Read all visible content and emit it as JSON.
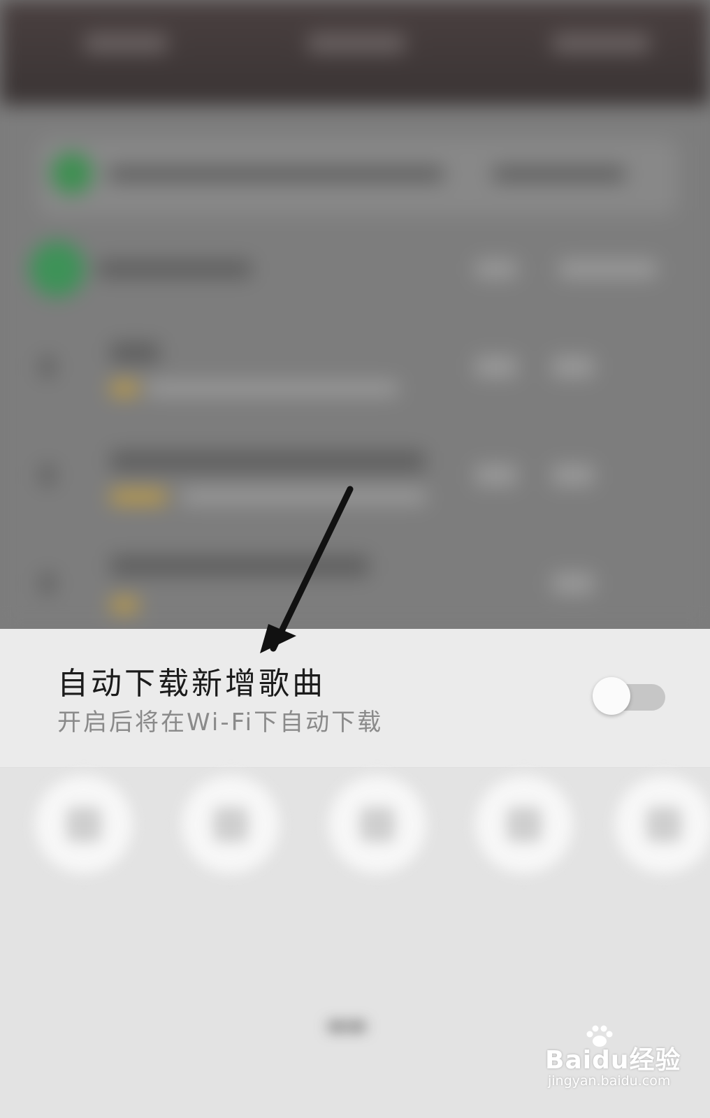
{
  "setting": {
    "title": "自动下载新增歌曲",
    "subtitle": "开启后将在Wi-Fi下自动下载",
    "toggle_state": "off"
  },
  "watermark": {
    "logo": "Baidu经验",
    "url": "jingyan.baidu.com"
  },
  "colors": {
    "sheet_background": "#ebebeb",
    "toggle_track": "#c6c6c6",
    "toggle_knob": "#fbfbfb",
    "arrow": "#111111"
  },
  "icons": {
    "annotation_arrow": "arrow-down-left-icon",
    "watermark_paw": "paw-icon"
  }
}
